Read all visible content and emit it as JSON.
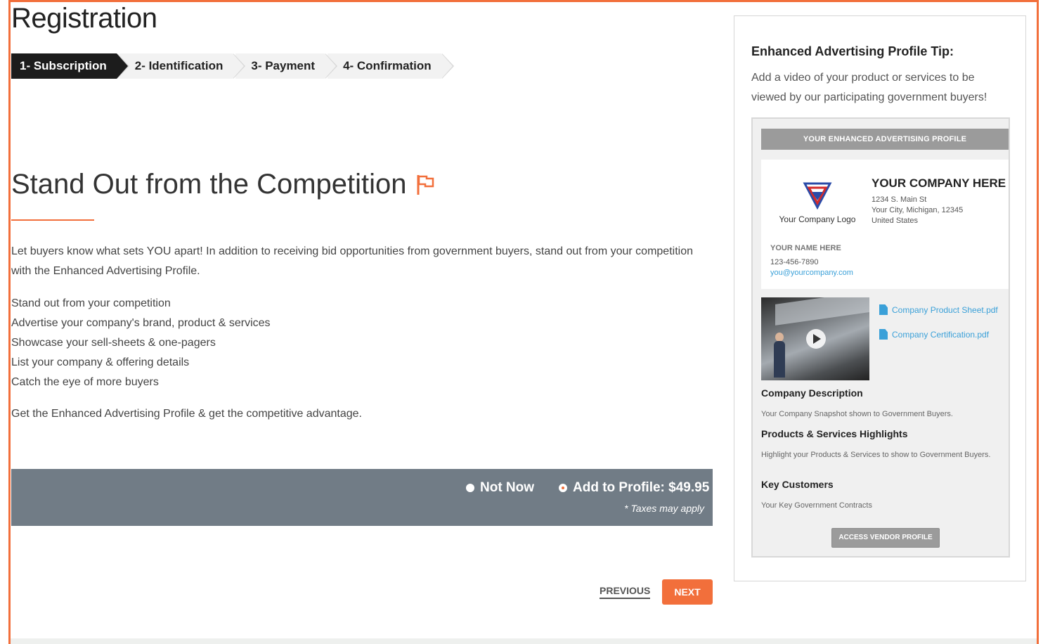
{
  "page": {
    "title": "Registration"
  },
  "steps": [
    {
      "label": "1- Subscription",
      "active": true
    },
    {
      "label": "2- Identification",
      "active": false
    },
    {
      "label": "3- Payment",
      "active": false
    },
    {
      "label": "4- Confirmation",
      "active": false
    }
  ],
  "main": {
    "headline": "Stand Out from the Competition",
    "intro": "Let buyers know what sets YOU apart! In addition to receiving bid opportunities from government buyers, stand out from your competition with the Enhanced Advertising Profile.",
    "benefits": [
      "Stand out from your competition",
      "Advertise your company's brand, product & services",
      "Showcase your sell-sheets & one-pagers",
      "List your company & offering details",
      "Catch the eye of more buyers"
    ],
    "closing": "Get the Enhanced Advertising Profile & get the competitive advantage."
  },
  "choice": {
    "not_now_label": "Not Now",
    "add_label": "Add to Profile: $49.95",
    "selected": "add",
    "taxes_note": "* Taxes may apply"
  },
  "nav": {
    "previous_label": "PREVIOUS",
    "next_label": "NEXT"
  },
  "tip": {
    "title": "Enhanced Advertising Profile Tip:",
    "text": "Add a video of your product or services to be viewed by our participating government buyers!",
    "preview": {
      "header": "YOUR ENHANCED ADVERTISING PROFILE",
      "logo_label": "Your Company Logo",
      "company_name": "YOUR COMPANY HERE",
      "address_line1": "1234 S. Main St",
      "address_line2": "Your City, Michigan, 12345",
      "address_line3": "United States",
      "contact_name": "YOUR NAME HERE",
      "phone": "123-456-7890",
      "email": "you@yourcompany.com",
      "files": [
        "Company Product Sheet.pdf",
        "Company Certification.pdf"
      ],
      "sections": [
        {
          "title": "Company Description",
          "text": "Your Company Snapshot shown to Government Buyers."
        },
        {
          "title": "Products & Services Highlights",
          "text": "Highlight your Products & Services to show to Government Buyers."
        },
        {
          "title": "Key Customers",
          "text": "Your Key Government Contracts"
        }
      ],
      "access_button": "ACCESS VENDOR PROFILE"
    }
  },
  "colors": {
    "accent": "#f26f3b",
    "bar": "#717c86",
    "link": "#3aa0d8"
  }
}
